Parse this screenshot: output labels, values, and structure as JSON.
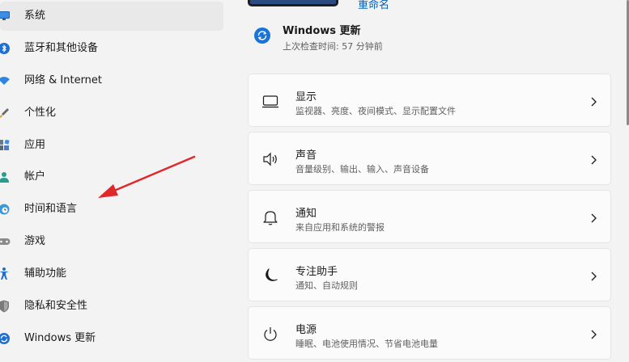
{
  "sidebar": {
    "items": [
      {
        "label": "系统",
        "icon": "monitor-icon",
        "selected": true
      },
      {
        "label": "蓝牙和其他设备",
        "icon": "bluetooth-icon"
      },
      {
        "label": "网络 & Internet",
        "icon": "wifi-icon"
      },
      {
        "label": "个性化",
        "icon": "brush-icon"
      },
      {
        "label": "应用",
        "icon": "apps-icon"
      },
      {
        "label": "帐户",
        "icon": "person-icon"
      },
      {
        "label": "时间和语言",
        "icon": "globe-clock-icon"
      },
      {
        "label": "游戏",
        "icon": "gamepad-icon"
      },
      {
        "label": "辅助功能",
        "icon": "accessibility-icon"
      },
      {
        "label": "隐私和安全性",
        "icon": "shield-icon"
      },
      {
        "label": "Windows 更新",
        "icon": "windows-update-icon"
      }
    ]
  },
  "header": {
    "rename_label": "重命名"
  },
  "windows_update": {
    "title": "Windows 更新",
    "subtitle": "上次检查时间: 57 分钟前"
  },
  "cards": [
    {
      "title": "显示",
      "subtitle": "监视器、亮度、夜间模式、显示配置文件",
      "icon": "display-icon"
    },
    {
      "title": "声音",
      "subtitle": "音量级别、输出、输入、声音设备",
      "icon": "speaker-icon"
    },
    {
      "title": "通知",
      "subtitle": "来自应用和系统的警报",
      "icon": "bell-icon"
    },
    {
      "title": "专注助手",
      "subtitle": "通知、自动规则",
      "icon": "moon-icon"
    },
    {
      "title": "电源",
      "subtitle": "睡眠、电池使用情况、节省电池电量",
      "icon": "power-icon"
    }
  ],
  "colors": {
    "accent": "#0067c0",
    "annotation_arrow": "#e0282b"
  }
}
